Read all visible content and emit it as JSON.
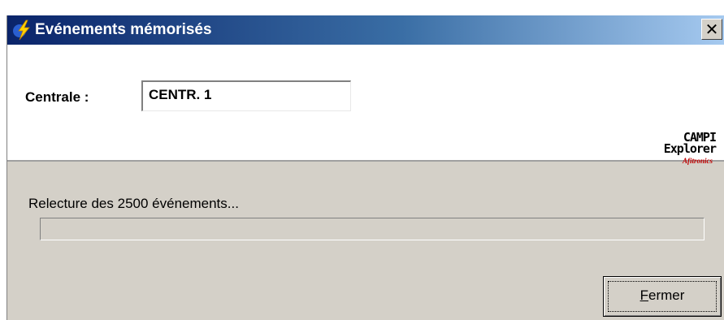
{
  "window": {
    "title": "Evénements mémorisés",
    "title_icon": "lightning-icon",
    "close_glyph": "✕"
  },
  "form": {
    "centrale_label": "Centrale :",
    "centrale_value": "CENTR. 1"
  },
  "logo": {
    "line1": "CAMPI",
    "line2": "Explorer",
    "line3": "Afitronics"
  },
  "status": {
    "text": "Relecture des 2500 événements...",
    "progress": 0
  },
  "buttons": {
    "fermer_first": "F",
    "fermer_rest": "ermer"
  },
  "colors": {
    "titlebar_start": "#0a246a",
    "titlebar_end": "#a6caf0",
    "dialog_bg": "#d4d0c8",
    "logo_accent": "#c00000"
  }
}
